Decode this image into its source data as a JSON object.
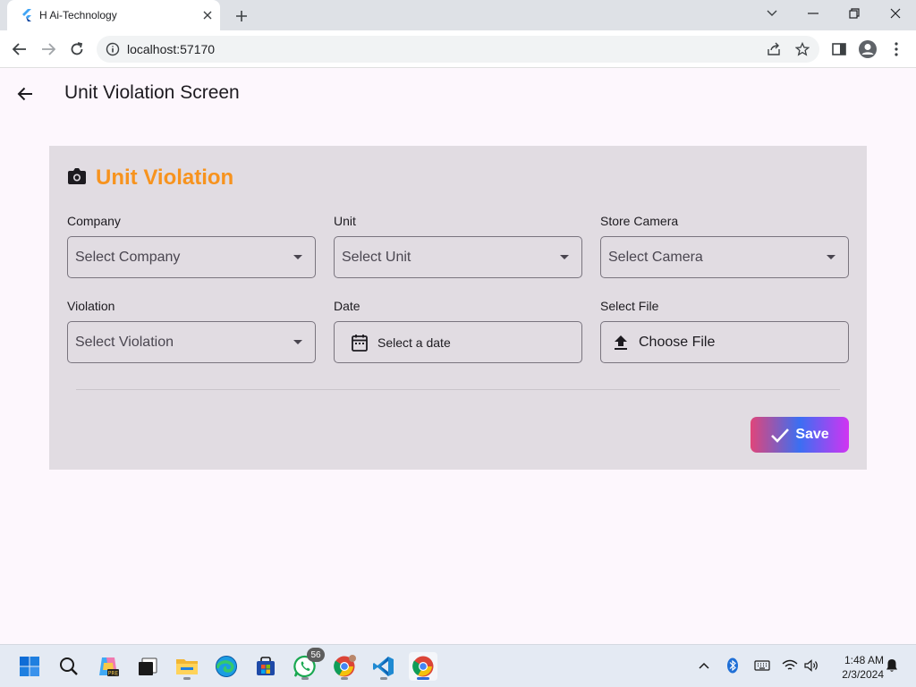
{
  "browser": {
    "tab_title": "H Ai-Technology",
    "url": "localhost:57170"
  },
  "appbar": {
    "title": "Unit Violation Screen"
  },
  "form": {
    "heading": "Unit Violation",
    "fields": {
      "company": {
        "label": "Company",
        "placeholder": "Select Company"
      },
      "unit": {
        "label": "Unit",
        "placeholder": "Select Unit"
      },
      "camera": {
        "label": "Store Camera",
        "placeholder": "Select Camera"
      },
      "violation": {
        "label": "Violation",
        "placeholder": "Select Violation"
      },
      "date": {
        "label": "Date",
        "button": "Select a date"
      },
      "file": {
        "label": "Select File",
        "button": "Choose File"
      }
    },
    "save_label": "Save"
  },
  "colors": {
    "heading": "#f7931e",
    "card": "#e1dce2",
    "page": "#fdf7fd"
  },
  "taskbar": {
    "apps": [
      "start-icon",
      "search-icon",
      "copilot-icon",
      "task-view-icon",
      "file-explorer-icon",
      "edge-icon",
      "store-icon",
      "whatsapp-icon",
      "chrome-icon",
      "vscode-icon",
      "chrome-active-icon"
    ],
    "whatsapp_badge": "56",
    "time": "1:48 AM",
    "date": "2/3/2024"
  }
}
